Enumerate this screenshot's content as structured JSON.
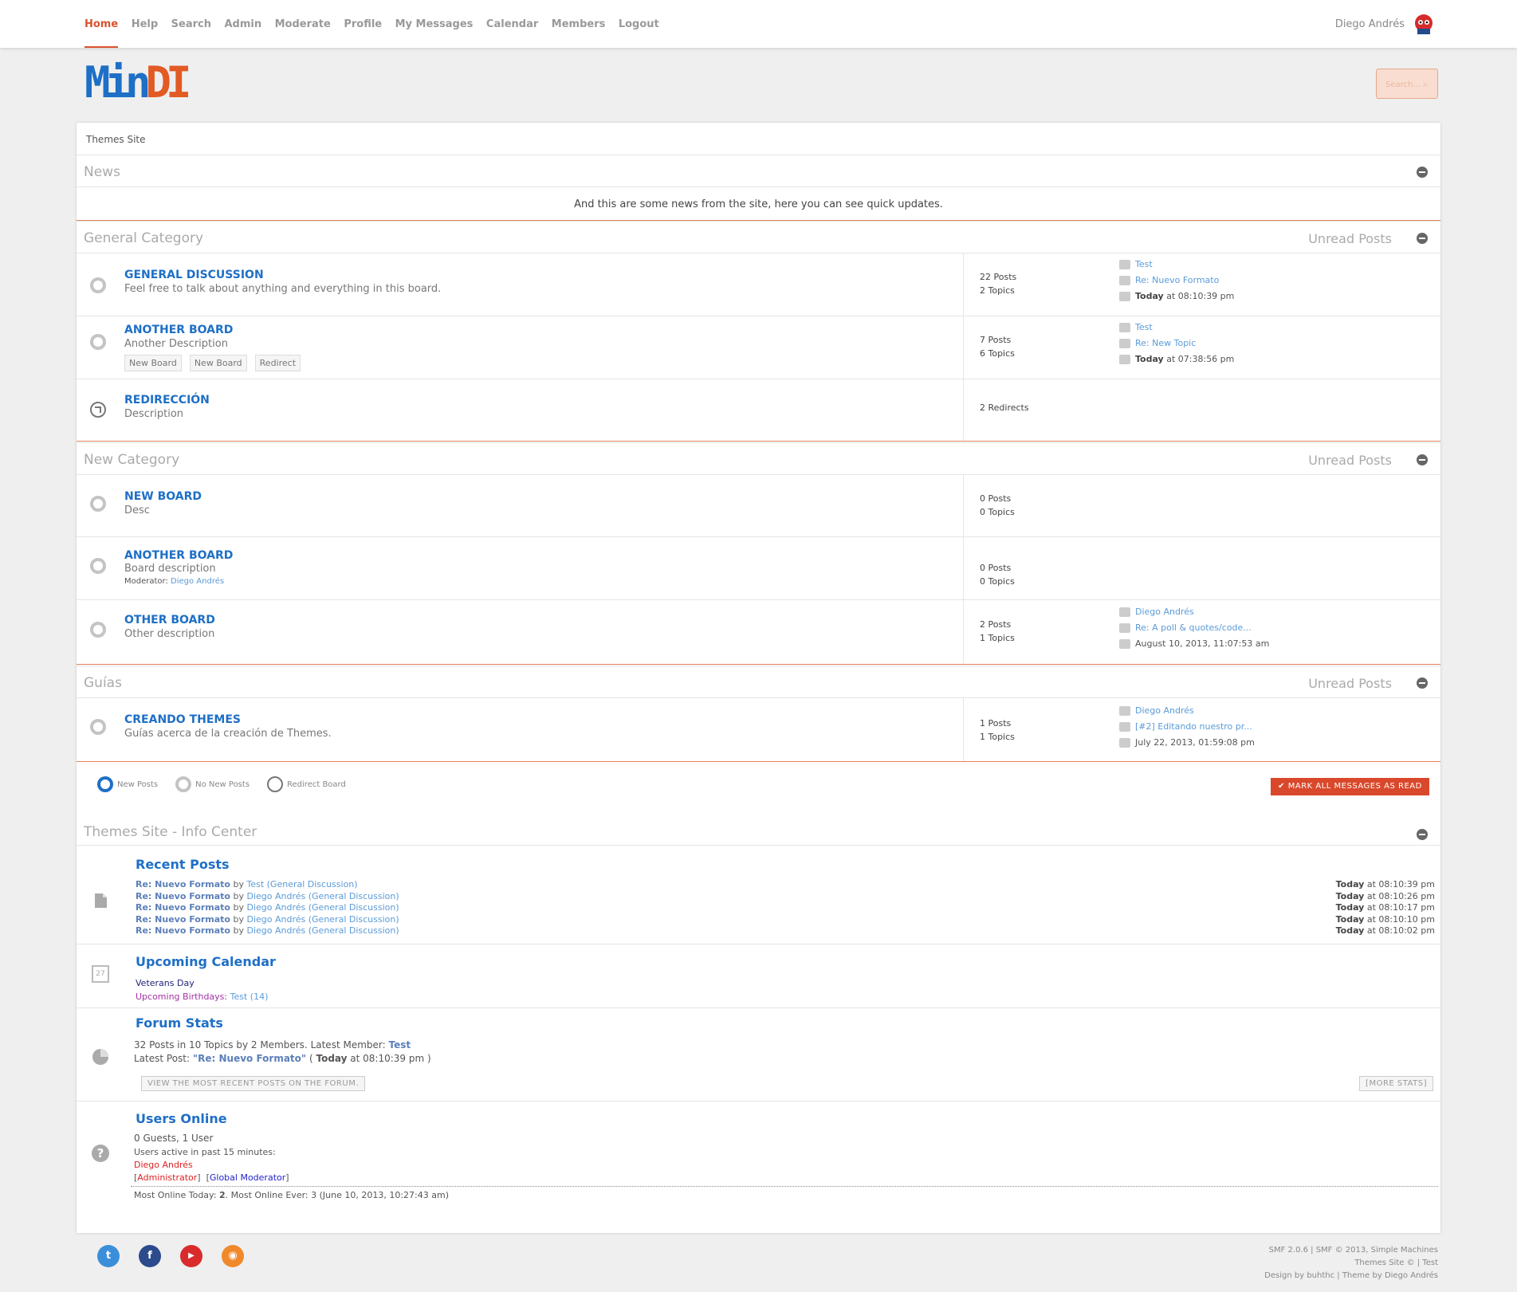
{
  "nav": {
    "items": [
      "Home",
      "Help",
      "Search",
      "Admin",
      "Moderate",
      "Profile",
      "My Messages",
      "Calendar",
      "Members",
      "Logout"
    ],
    "active": "Home"
  },
  "user": {
    "name": "Diego Andrés"
  },
  "logo": {
    "part1": "Min",
    "part2": "DI"
  },
  "search": {
    "placeholder": "Search... ⌕"
  },
  "breadcrumb": "Themes Site",
  "news": {
    "title": "News",
    "text": "And this are some news from the site, here you can see quick updates."
  },
  "categories": [
    {
      "title": "General Category",
      "unread": "Unread Posts",
      "boards": [
        {
          "name": "GENERAL DISCUSSION",
          "desc": "Feel free to talk about anything and everything in this board.",
          "posts": "22 Posts",
          "topics": "2 Topics",
          "last_user": "Test",
          "last_topic": "Re: Nuevo Formato",
          "last_date_bold": "Today",
          "last_date": " at 08:10:39 pm"
        },
        {
          "name": "ANOTHER BOARD",
          "desc": "Another Description",
          "children": [
            "New Board",
            "New Board",
            "Redirect"
          ],
          "posts": "7 Posts",
          "topics": "6 Topics",
          "last_user": "Test",
          "last_topic": "Re: New Topic",
          "last_date_bold": "Today",
          "last_date": " at 07:38:56 pm"
        },
        {
          "name": "REDIRECCIÓN",
          "desc": "Description",
          "redirects": "2 Redirects"
        }
      ]
    },
    {
      "title": "New Category",
      "unread": "Unread Posts",
      "boards": [
        {
          "name": "NEW BOARD",
          "desc": "Desc",
          "posts": "0 Posts",
          "topics": "0 Topics"
        },
        {
          "name": "ANOTHER BOARD",
          "desc": "Board description",
          "mod_label": "Moderator:",
          "mod_name": "Diego Andrés",
          "posts": "0 Posts",
          "topics": "0 Topics"
        },
        {
          "name": "OTHER BOARD",
          "desc": "Other description",
          "posts": "2 Posts",
          "topics": "1 Topics",
          "last_user": "Diego Andrés",
          "last_topic": "Re: A poll & quotes/code...",
          "last_date": "August 10, 2013, 11:07:53 am"
        }
      ]
    },
    {
      "title": "Guías",
      "unread": "Unread Posts",
      "boards": [
        {
          "name": "CREANDO THEMES",
          "desc": "Guías acerca de la creación de Themes.",
          "posts": "1 Posts",
          "topics": "1 Topics",
          "last_user": "Diego Andrés",
          "last_topic": "[#2] Editando nuestro pr...",
          "last_date": "July 22, 2013, 01:59:08 pm"
        }
      ]
    }
  ],
  "legend": {
    "new": "New Posts",
    "nonew": "No New Posts",
    "redirect": "Redirect Board"
  },
  "mark_read": "✔  MARK ALL MESSAGES AS READ",
  "info": {
    "title": "Themes Site - Info Center",
    "recent": {
      "title": "Recent Posts",
      "posts": [
        {
          "subject": "Re: Nuevo Formato",
          "by": " by ",
          "user": "Test",
          "board": "(General Discussion)",
          "time_bold": "Today",
          "time": " at 08:10:39 pm"
        },
        {
          "subject": "Re: Nuevo Formato",
          "by": " by ",
          "user": "Diego Andrés",
          "board": "(General Discussion)",
          "time_bold": "Today",
          "time": " at 08:10:26 pm"
        },
        {
          "subject": "Re: Nuevo Formato",
          "by": " by ",
          "user": "Diego Andrés",
          "board": "(General Discussion)",
          "time_bold": "Today",
          "time": " at 08:10:17 pm"
        },
        {
          "subject": "Re: Nuevo Formato",
          "by": " by ",
          "user": "Diego Andrés",
          "board": "(General Discussion)",
          "time_bold": "Today",
          "time": " at 08:10:10 pm"
        },
        {
          "subject": "Re: Nuevo Formato",
          "by": " by ",
          "user": "Diego Andrés",
          "board": "(General Discussion)",
          "time_bold": "Today",
          "time": " at 08:10:02 pm"
        }
      ]
    },
    "calendar": {
      "title": "Upcoming Calendar",
      "holiday": "Veterans Day",
      "bday_label": "Upcoming Birthdays:",
      "bday_user": "Test (14)",
      "icon_day": "27"
    },
    "stats": {
      "title": "Forum Stats",
      "line1": "32 Posts in 10 Topics by 2 Members. Latest Member: ",
      "latest_member": "Test",
      "line2_pre": "Latest Post: ",
      "latest_post": "\"Re: Nuevo Formato\"",
      "line2_open": " ( ",
      "line2_bold": "Today",
      "line2_time": " at 08:10:39 pm )",
      "recent_btn": "VIEW THE MOST RECENT POSTS ON THE FORUM.",
      "more_btn": "[MORE STATS]"
    },
    "online": {
      "title": "Users Online",
      "counts": "0 Guests, 1 User",
      "active_label": "Users active in past 15 minutes:",
      "user": "Diego Andrés",
      "group1": "Administrator",
      "group2": "Global Moderator",
      "most": "Most Online Today: ",
      "most_today": "2",
      "most_rest": ". Most Online Ever: 3 (June 10, 2013, 10:27:43 am)"
    }
  },
  "footer": {
    "line1": "SMF 2.0.6 | SMF © 2013, Simple Machines",
    "line2": "Themes Site © | Test",
    "line3": "Design by buhthc | Theme by Diego Andrés"
  },
  "social": [
    {
      "name": "twitter-icon",
      "label": "t",
      "color": "#3b8fd9"
    },
    {
      "name": "facebook-icon",
      "label": "f",
      "color": "#2c4b8c"
    },
    {
      "name": "youtube-icon",
      "label": "▶",
      "color": "#d92b2b"
    },
    {
      "name": "rss-icon",
      "label": "◉",
      "color": "#f0892b"
    }
  ]
}
